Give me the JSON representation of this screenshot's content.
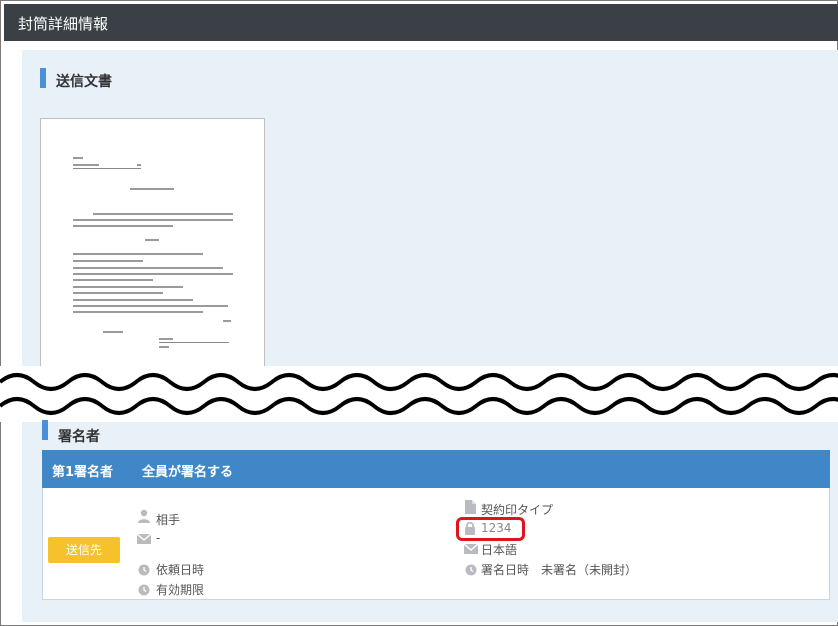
{
  "header": {
    "title": "封筒詳細情報"
  },
  "sections": {
    "document": {
      "title": "送信文書"
    },
    "signers": {
      "title": "署名者"
    }
  },
  "signer": {
    "order_label": "第1署名者",
    "mode_label": "全員が署名する",
    "badge": "送信先",
    "name_label": "相手",
    "email_value": "-",
    "requested_label": "依頼日時",
    "expiry_label": "有効期限",
    "contract_type_label": "契約印タイプ",
    "access_code": "1234",
    "language": "日本語",
    "signed_label": "署名日時",
    "signed_status": "未署名（未開封）"
  },
  "icons": {
    "person": "person-icon",
    "mail": "mail-icon",
    "clock": "clock-icon",
    "document": "document-icon",
    "lock": "lock-icon"
  },
  "colors": {
    "header_bg": "#3a4045",
    "accent": "#4a90d9",
    "signer_header": "#3f87c7",
    "badge": "#f5c22b",
    "highlight": "#e0141c"
  }
}
